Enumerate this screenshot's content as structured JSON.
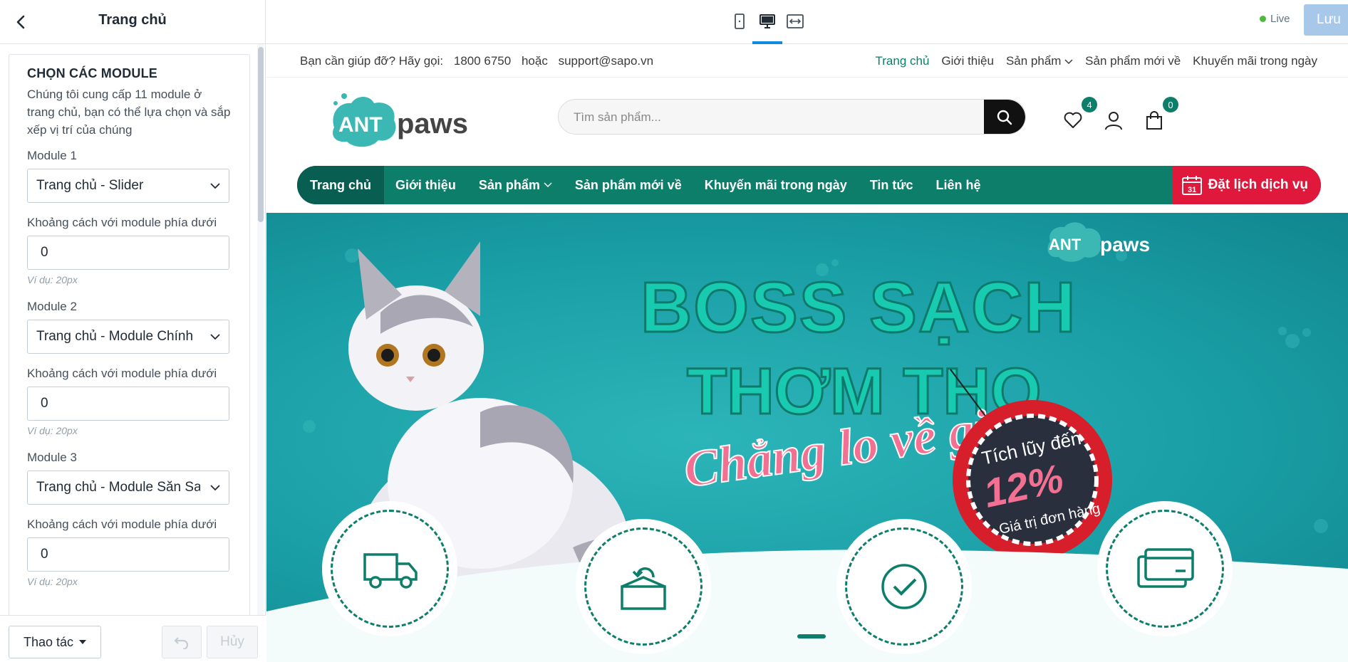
{
  "editor": {
    "title": "Trang chủ",
    "card_heading": "CHỌN CÁC MODULE",
    "card_desc": "Chúng tôi cung cấp 11 module ở trang chủ, bạn có thể lựa chọn và sắp xếp vị trí của chúng",
    "modules": [
      {
        "label": "Module 1",
        "value": "Trang chủ - Slider",
        "spacing_label": "Khoảng cách với module phía dưới",
        "spacing_value": "0",
        "hint": "Ví dụ: 20px"
      },
      {
        "label": "Module 2",
        "value": "Trang chủ - Module Chính",
        "spacing_label": "Khoảng cách với module phía dưới",
        "spacing_value": "0",
        "hint": "Ví dụ: 20px"
      },
      {
        "label": "Module 3",
        "value": "Trang chủ - Module Săn Sale",
        "spacing_label": "Khoảng cách với module phía dưới",
        "spacing_value": "0",
        "hint": "Ví dụ: 20px"
      }
    ],
    "footer": {
      "actions_label": "Thao tác",
      "cancel_label": "Hủy"
    }
  },
  "toolbar": {
    "live_label": "Live",
    "save_label": "Lưu",
    "devices": [
      "mobile-icon",
      "desktop-icon",
      "fullwidth-icon"
    ],
    "active_device": "desktop-icon"
  },
  "site": {
    "help_text": "Bạn cần giúp đỡ? Hãy gọi:",
    "phone": "1800 6750",
    "or_text": "hoặc",
    "email": "support@sapo.vn",
    "top_links": [
      "Trang chủ",
      "Giới thiệu",
      "Sản phẩm",
      "Sản phẩm mới về",
      "Khuyến mãi trong ngày"
    ],
    "logo_text_a": "ANT",
    "logo_text_b": "paws",
    "search_placeholder": "Tìm sản phẩm...",
    "wishlist_count": "4",
    "cart_count": "0",
    "nav": [
      "Trang chủ",
      "Giới thiệu",
      "Sản phẩm",
      "Sản phẩm mới về",
      "Khuyến mãi trong ngày",
      "Tin tức",
      "Liên hệ"
    ],
    "book_label": "Đặt lịch dịch vụ",
    "book_day": "31",
    "banner": {
      "line1": "BOSS SẠCH",
      "line2": "THƠM THO",
      "line3": "Chẳng lo về giá",
      "tag_line1": "Tích lũy đến",
      "tag_value": "12%",
      "tag_line2": "Giá trị đơn hàng",
      "logo_a": "ANT",
      "logo_b": "paws"
    },
    "accent": "#0d7e6a",
    "book_color": "#e0183c"
  }
}
